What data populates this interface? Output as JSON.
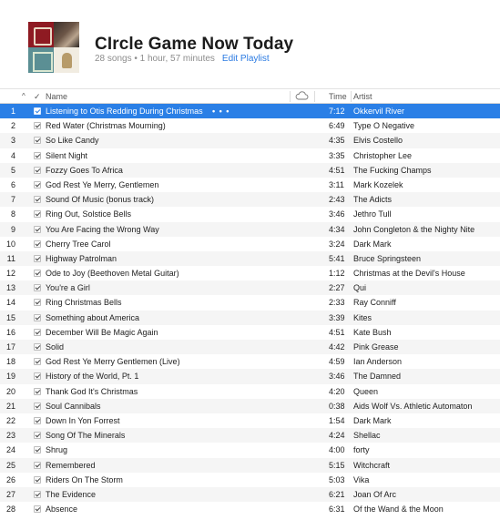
{
  "playlist": {
    "title": "CIrcle Game Now Today",
    "meta": "28 songs • 1 hour, 57 minutes",
    "edit_label": "Edit Playlist"
  },
  "columns": {
    "sort_arrow": "^",
    "check": "✓",
    "name": "Name",
    "time": "Time",
    "artist": "Artist"
  },
  "selected_more": "• • •",
  "accent_color": "#2a7fe6",
  "tracks": [
    {
      "num": "1",
      "name": "Listening to Otis Redding During Christmas",
      "time": "7:12",
      "artist": "Okkervil River"
    },
    {
      "num": "2",
      "name": "Red Water (Christmas Mourning)",
      "time": "6:49",
      "artist": "Type O Negative"
    },
    {
      "num": "3",
      "name": "So Like Candy",
      "time": "4:35",
      "artist": "Elvis Costello"
    },
    {
      "num": "4",
      "name": "Silent Night",
      "time": "3:35",
      "artist": "Christopher Lee"
    },
    {
      "num": "5",
      "name": "Fozzy Goes To Africa",
      "time": "4:51",
      "artist": "The Fucking Champs"
    },
    {
      "num": "6",
      "name": "God Rest Ye Merry, Gentlemen",
      "time": "3:11",
      "artist": "Mark Kozelek"
    },
    {
      "num": "7",
      "name": "Sound Of Music (bonus track)",
      "time": "2:43",
      "artist": "The Adicts"
    },
    {
      "num": "8",
      "name": "Ring Out, Solstice Bells",
      "time": "3:46",
      "artist": "Jethro Tull"
    },
    {
      "num": "9",
      "name": "You Are Facing the Wrong Way",
      "time": "4:34",
      "artist": "John Congleton & the Nighty Nite"
    },
    {
      "num": "10",
      "name": "Cherry Tree Carol",
      "time": "3:24",
      "artist": "Dark Mark"
    },
    {
      "num": "11",
      "name": "Highway Patrolman",
      "time": "5:41",
      "artist": "Bruce Springsteen"
    },
    {
      "num": "12",
      "name": "Ode to Joy (Beethoven Metal Guitar)",
      "time": "1:12",
      "artist": "Christmas at the Devil's House"
    },
    {
      "num": "13",
      "name": "You're a Girl",
      "time": "2:27",
      "artist": "Qui"
    },
    {
      "num": "14",
      "name": "Ring Christmas Bells",
      "time": "2:33",
      "artist": "Ray Conniff"
    },
    {
      "num": "15",
      "name": "Something about America",
      "time": "3:39",
      "artist": "Kites"
    },
    {
      "num": "16",
      "name": "December Will Be Magic Again",
      "time": "4:51",
      "artist": "Kate Bush"
    },
    {
      "num": "17",
      "name": "Solid",
      "time": "4:42",
      "artist": "Pink Grease"
    },
    {
      "num": "18",
      "name": "God Rest Ye Merry Gentlemen (Live)",
      "time": "4:59",
      "artist": "Ian Anderson"
    },
    {
      "num": "19",
      "name": "History of the World, Pt. 1",
      "time": "3:46",
      "artist": "The Damned"
    },
    {
      "num": "20",
      "name": "Thank God It's Christmas",
      "time": "4:20",
      "artist": "Queen"
    },
    {
      "num": "21",
      "name": "Soul Cannibals",
      "time": "0:38",
      "artist": "Aids Wolf Vs. Athletic Automaton"
    },
    {
      "num": "22",
      "name": "Down In Yon Forrest",
      "time": "1:54",
      "artist": "Dark Mark"
    },
    {
      "num": "23",
      "name": "Song Of The Minerals",
      "time": "4:24",
      "artist": "Shellac"
    },
    {
      "num": "24",
      "name": "Shrug",
      "time": "4:00",
      "artist": "forty"
    },
    {
      "num": "25",
      "name": "Remembered",
      "time": "5:15",
      "artist": "Witchcraft"
    },
    {
      "num": "26",
      "name": "Riders On The Storm",
      "time": "5:03",
      "artist": "Vika"
    },
    {
      "num": "27",
      "name": "The Evidence",
      "time": "6:21",
      "artist": "Joan Of Arc"
    },
    {
      "num": "28",
      "name": "Absence",
      "time": "6:31",
      "artist": "Of the Wand & the Moon"
    }
  ]
}
